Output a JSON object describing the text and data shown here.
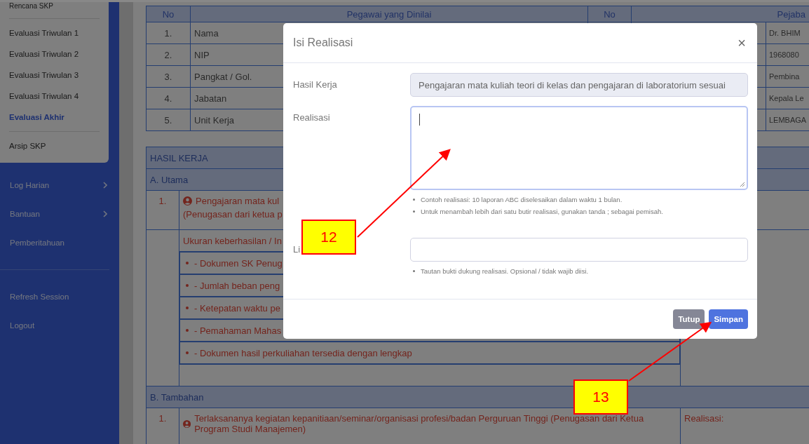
{
  "sidebar": {
    "menu_groups": [
      [
        {
          "label": "Rencana SKP",
          "selected": false
        }
      ],
      [
        {
          "label": "Evaluasi Triwulan 1",
          "selected": false
        },
        {
          "label": "Evaluasi Triwulan 2",
          "selected": false
        },
        {
          "label": "Evaluasi Triwulan 3",
          "selected": false
        },
        {
          "label": "Evaluasi Triwulan 4",
          "selected": false
        },
        {
          "label": "Evaluasi Akhir",
          "selected": true
        }
      ],
      [
        {
          "label": "Arsip SKP",
          "selected": false
        }
      ]
    ],
    "nav_groups": [
      [
        {
          "label": "Log Harian",
          "submenu": true
        },
        {
          "label": "Bantuan",
          "submenu": true
        },
        {
          "label": "Pemberitahuan",
          "submenu": false
        }
      ],
      [
        {
          "label": "Refresh Session",
          "submenu": false
        },
        {
          "label": "Logout",
          "submenu": false
        }
      ]
    ]
  },
  "identity_table": {
    "headers": [
      "No",
      "Pegawai yang Dinilai",
      "No",
      "Pejaba"
    ],
    "rows": [
      {
        "no": "1.",
        "label": "Nama",
        "value": "Dr. BHIM"
      },
      {
        "no": "2.",
        "label": "NIP",
        "value": "1968080"
      },
      {
        "no": "3.",
        "label": "Pangkat / Gol.",
        "value": "Pembina"
      },
      {
        "no": "4.",
        "label": "Jabatan",
        "value": "Kepala Le"
      },
      {
        "no": "5.",
        "label": "Unit Kerja",
        "value": "LEMBAGA"
      }
    ]
  },
  "work_table": {
    "title": "HASIL KERJA",
    "sections": [
      {
        "title": "A. Utama",
        "items": [
          {
            "no": "1.",
            "text": "Pengajaran mata kul",
            "text_line_2": "(Penugasan dari ketua p",
            "indicator_title": "Ukuran keberhasilan / In",
            "indicators": [
              "- Dokumen SK Penug",
              "- Jumlah beban peng",
              "- Ketepatan waktu pe",
              "- Pemahaman Mahas",
              "- Dokumen hasil perkuliahan tersedia dengan lengkap"
            ]
          }
        ]
      },
      {
        "title": "B. Tambahan",
        "items": [
          {
            "no": "1.",
            "text": "Terlaksananya kegiatan kepanitiaan/seminar/organisasi profesi/badan Perguruan Tinggi (Penugasan dari Ketua Program Studi Manajemen)",
            "realisasi": "Realisasi:"
          }
        ]
      }
    ]
  },
  "modal": {
    "title": "Isi Realisasi",
    "close": "×",
    "fields": [
      {
        "kind": "readonly",
        "label": "Hasil Kerja",
        "value": "Pengajaran mata kuliah teori di kelas dan pengajaran di laboratorium sesuai"
      },
      {
        "kind": "textarea",
        "label": "Realisasi",
        "focused": true,
        "hints": [
          "Contoh realisasi: 10 laporan ABC diselesaikan dalam waktu 1 bulan.",
          "Untuk menambah lebih dari satu butir realisasi, gunakan tanda ; sebagai pemisah."
        ]
      },
      {
        "kind": "input",
        "label": "Li",
        "hints": [
          "Tautan bukti dukung realisasi. Opsional / tidak wajib diisi."
        ]
      }
    ],
    "buttons": [
      {
        "label": "Tutup",
        "kind": "secondary"
      },
      {
        "label": "Simpan",
        "kind": "primary"
      }
    ]
  },
  "annotations": [
    {
      "label": "12"
    },
    {
      "label": "13"
    }
  ]
}
